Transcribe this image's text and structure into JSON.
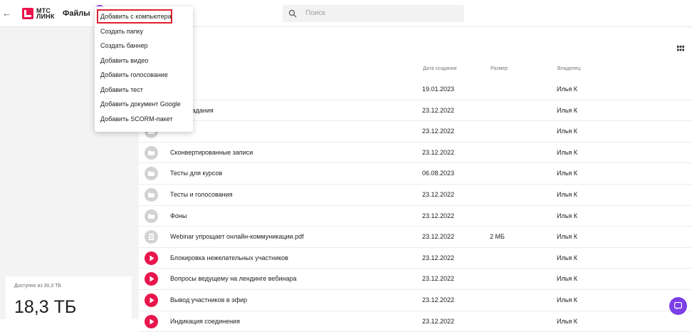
{
  "header": {
    "back_glyph": "←",
    "logo_line1": "МТС",
    "logo_line2": "ЛИНК",
    "app_title": "Файлы",
    "search_placeholder": "Поиск"
  },
  "colors": {
    "brand_red": "#e8164c",
    "accent_purple": "#7b3ee8",
    "highlight_red": "#e0202e",
    "folder_grey": "#d2d2d2"
  },
  "menu": {
    "items": [
      "Добавить с компьютера",
      "Создать папку",
      "Создать баннер",
      "Добавить видео",
      "Добавить голосование",
      "Добавить тест",
      "Добавить документ Google",
      "Добавить SCORM-пакет"
    ]
  },
  "columns": {
    "date": "Дата создания",
    "size": "Размер",
    "owner": "Владелец"
  },
  "rows": [
    {
      "icon": "folder-icon",
      "name": "…ы",
      "date": "19.01.2023",
      "size": "",
      "owner": "Илья К"
    },
    {
      "icon": "folder-icon",
      "name": "…ние задания",
      "date": "23.12.2022",
      "size": "",
      "owner": "Илья К"
    },
    {
      "icon": "folder-icon",
      "name": "",
      "date": "23.12.2022",
      "size": "",
      "owner": "Илья К"
    },
    {
      "icon": "folder-icon",
      "name": "Сконвертированные записи",
      "date": "23.12.2022",
      "size": "",
      "owner": "Илья К"
    },
    {
      "icon": "folder-icon",
      "name": "Тесты для курсов",
      "date": "06.08.2023",
      "size": "",
      "owner": "Илья К"
    },
    {
      "icon": "folder-icon",
      "name": "Тесты и голосования",
      "date": "23.12.2022",
      "size": "",
      "owner": "Илья К"
    },
    {
      "icon": "folder-icon",
      "name": "Фоны",
      "date": "23.12.2022",
      "size": "",
      "owner": "Илья К"
    },
    {
      "icon": "document-icon",
      "name": "Webinar упрощает онлайн-коммуникации.pdf",
      "date": "23.12.2022",
      "size": "2 МБ",
      "owner": "Илья К"
    },
    {
      "icon": "video-play-icon",
      "name": "Блокировка нежелательных участников",
      "date": "23.12.2022",
      "size": "",
      "owner": "Илья К"
    },
    {
      "icon": "video-play-icon",
      "name": "Вопросы ведущему на лендинге вебинара",
      "date": "23.12.2022",
      "size": "",
      "owner": "Илья К"
    },
    {
      "icon": "video-play-icon",
      "name": "Вывод участников в эфир",
      "date": "23.12.2022",
      "size": "",
      "owner": "Илья К"
    },
    {
      "icon": "video-play-icon",
      "name": "Индикация соединения",
      "date": "23.12.2022",
      "size": "",
      "owner": "Илья К"
    }
  ],
  "storage": {
    "label": "Доступно из 30,3 ТБ",
    "value": "18,3 ТБ"
  },
  "icons": {
    "back": "back-arrow-icon",
    "search": "search-icon",
    "grid_view": "grid-view-icon",
    "chat": "chat-icon"
  }
}
